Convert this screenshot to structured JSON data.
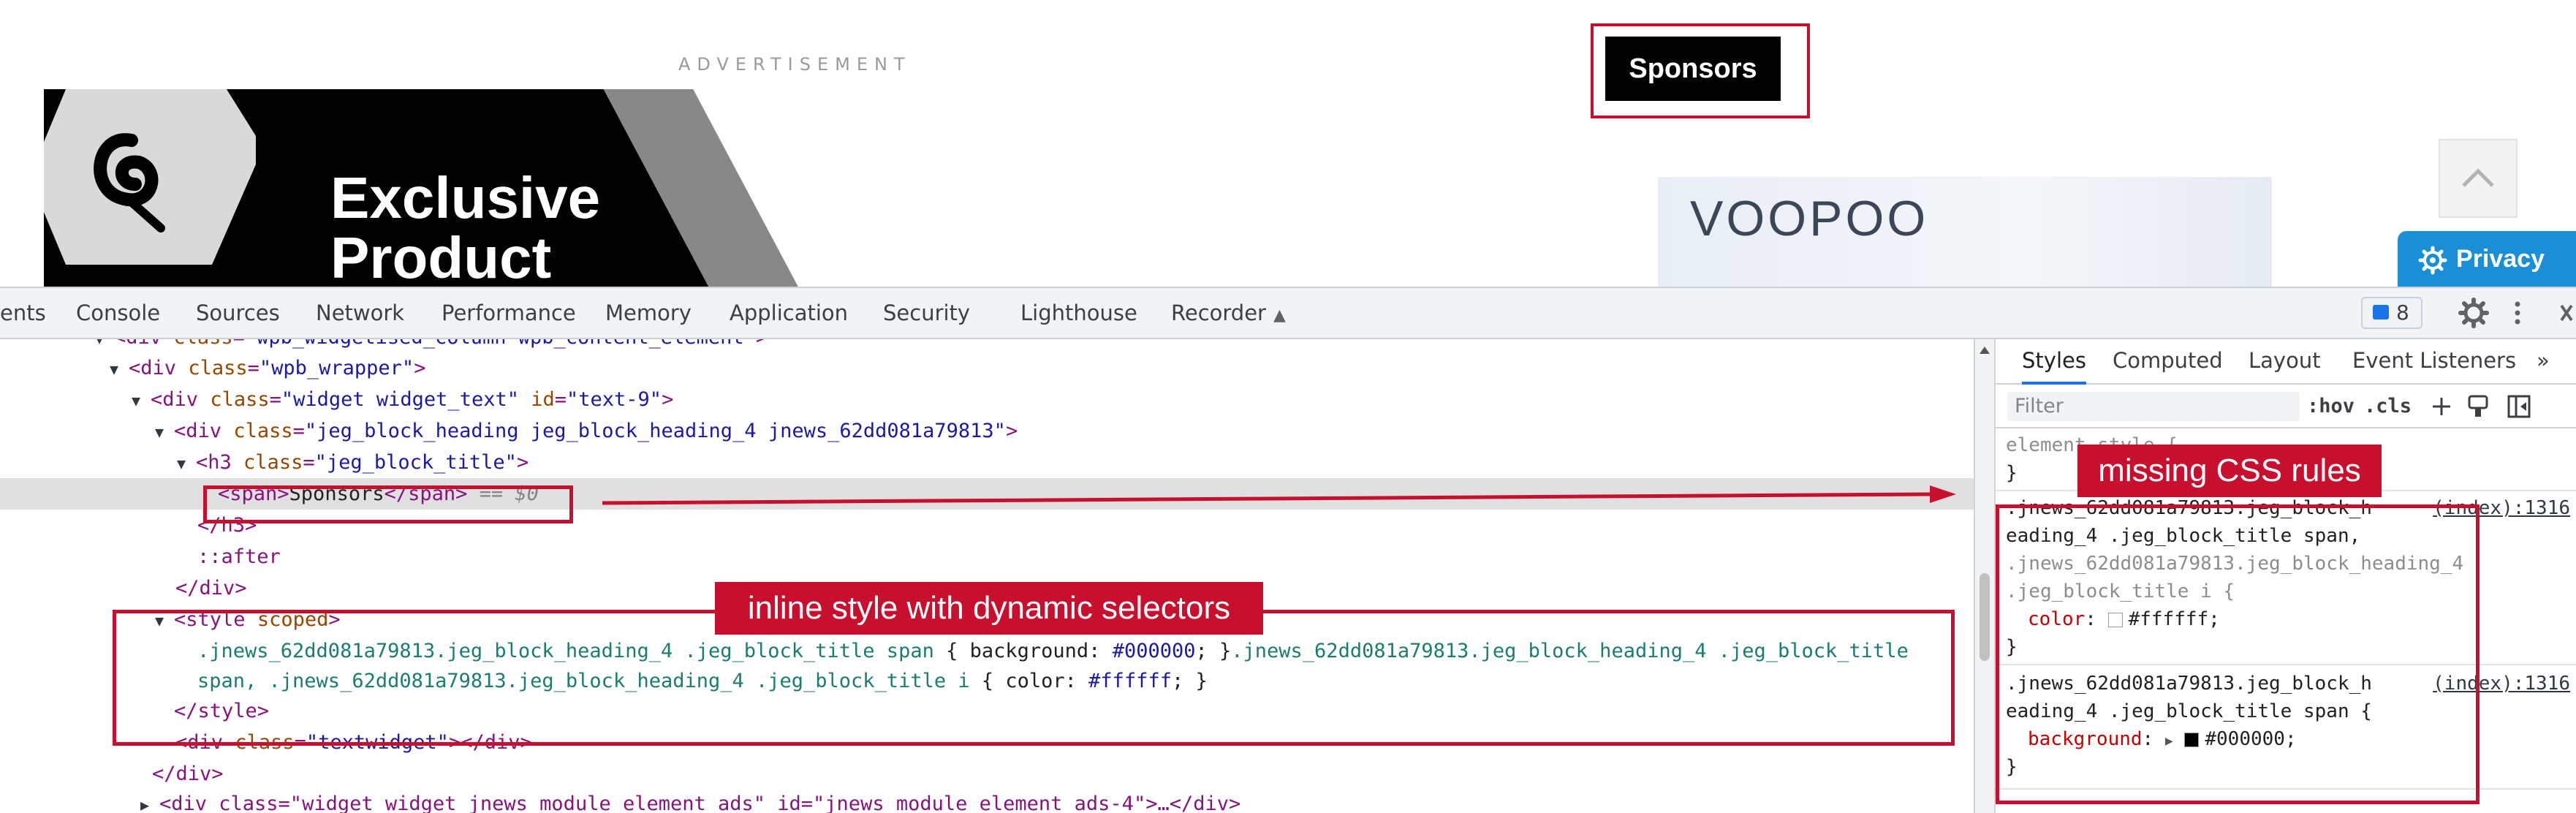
{
  "page": {
    "ad_label": "ADVERTISEMENT",
    "banner_title_line1": "Exclusive",
    "banner_title_line2": "Product",
    "sponsors_label": "Sponsors",
    "voopoo_text": "VOOPOO",
    "privacy_label": "Privacy"
  },
  "devtools": {
    "tabs": [
      "ents",
      "Console",
      "Sources",
      "Network",
      "Performance",
      "Memory",
      "Application",
      "Security",
      "Lighthouse",
      "Recorder"
    ],
    "issues_count": "8",
    "elements": {
      "l1_tag": "div",
      "l1_attr": "class",
      "l1_val": "\"wpb_widgetised_column wpb_content_element\"",
      "l2_tag": "div",
      "l2_attr": "class",
      "l2_val": "\"wpb_wrapper\"",
      "l3_tag": "div",
      "l3_attr1": "class",
      "l3_val1": "\"widget widget_text\"",
      "l3_attr2": "id",
      "l3_val2": "\"text-9\"",
      "l4_tag": "div",
      "l4_attr": "class",
      "l4_val": "\"jeg_block_heading jeg_block_heading_4 jnews_62dd081a79813\"",
      "l5_tag": "h3",
      "l5_attr": "class",
      "l5_val": "\"jeg_block_title\"",
      "l6_open": "<span>",
      "l6_text": "Sponsors",
      "l6_close": "</span>",
      "l6_eq": "== $0",
      "l7": "</h3>",
      "l8": "::after",
      "l9": "</div>",
      "l10_tag": "style",
      "l10_attr": "scoped",
      "l11_sel1": ".jnews_62dd081a79813.jeg_block_heading_4 .jeg_block_title span",
      "l11_body1": " { background: ",
      "l11_val1": "#000000",
      "l11_end1": "; }",
      "l11_sel2": ".jnews_62dd081a79813.jeg_block_heading_4 .jeg_block_title",
      "l12_sel": "span, .jnews_62dd081a79813.jeg_block_heading_4 .jeg_block_title i",
      "l12_body": " { color: ",
      "l12_val": "#ffffff",
      "l12_end": "; }",
      "l13": "</style>",
      "l14_tag": "div",
      "l14_attr": "class",
      "l14_val": "\"textwidget\"",
      "l15": "</div>",
      "l16": "<div class=\"widget widget_jnews_module_element_ads\" id=\"jnews_module_element_ads-4\">…</div>"
    },
    "styles": {
      "tabs": [
        "Styles",
        "Computed",
        "Layout",
        "Event Listeners",
        "»"
      ],
      "filter_placeholder": "Filter",
      "hov": ":hov",
      "cls": ".cls",
      "element_rule_start": "element.style {",
      "element_rule_end": "}",
      "rule1_line1": ".jnews_62dd081a79813.jeg_block_h",
      "rule1_line2": "eading_4 .jeg_block_title span,",
      "rule1_line3": ".jnews_62dd081a79813.jeg_block_heading_4",
      "rule1_line4": ".jeg_block_title i {",
      "rule1_prop": "color",
      "rule1_val": "#ffffff",
      "rule1_link": "(index):1316",
      "rule2_line1": ".jnews_62dd081a79813.jeg_block_h",
      "rule2_line2": "eading_4 .jeg_block_title span {",
      "rule2_prop": "background",
      "rule2_val": "#000000",
      "rule2_link": "(index):1316",
      "close_brace": "}"
    }
  },
  "annotations": {
    "missing_css": "missing CSS rules",
    "inline_style": "inline style with dynamic selectors"
  },
  "colors": {
    "accent_red": "#c8102e",
    "privacy_blue": "#1a8fd6",
    "devtools_blue": "#1a73e8"
  }
}
